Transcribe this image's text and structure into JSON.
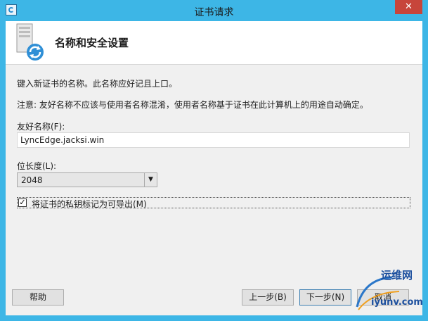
{
  "window": {
    "title": "证书请求",
    "close_label": "✕"
  },
  "header": {
    "title": "名称和安全设置"
  },
  "content": {
    "instruction": "键入新证书的名称。此名称应好记且上口。",
    "note": "注意: 友好名称不应该与使用者名称混淆，使用者名称基于证书在此计算机上的用途自动确定。",
    "friendly_name_label": "友好名称(F):",
    "friendly_name_value": "LyncEdge.jacksi.win",
    "bit_length_label": "位长度(L):",
    "bit_length_value": "2048",
    "exportable_label": "将证书的私钥标记为可导出(M)",
    "exportable_checked": true
  },
  "buttons": {
    "help": "帮助",
    "back": "上一步(B)",
    "next": "下一步(N)",
    "cancel": "取消"
  },
  "watermark": {
    "line1": "运维网",
    "line2": "iyunv.com"
  },
  "colors": {
    "titlebar": "#3db6e6",
    "close": "#c7453b",
    "client_bg": "#f0f0f0"
  }
}
